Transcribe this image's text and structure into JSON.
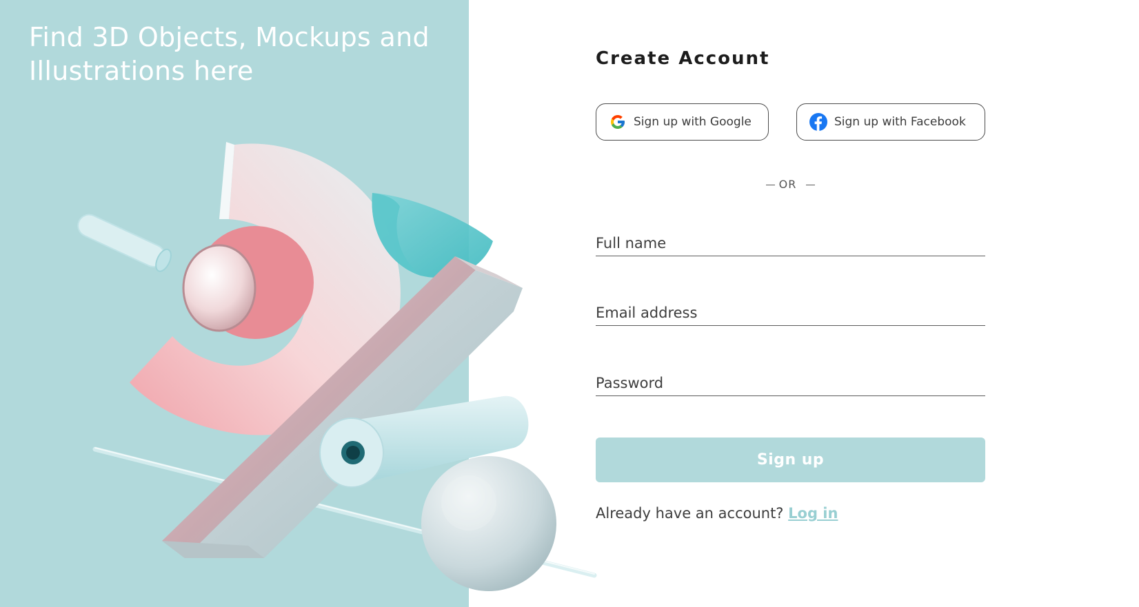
{
  "hero": {
    "title": "Find 3D Objects, Mockups and Illustrations here"
  },
  "form": {
    "title": "Create Account",
    "google_label": "Sign up with Google",
    "facebook_label": "Sign up with Facebook",
    "divider_label": "OR",
    "fields": {
      "full_name": {
        "value": "",
        "placeholder": "Full name"
      },
      "email": {
        "value": "",
        "placeholder": "Email address"
      },
      "password": {
        "value": "",
        "placeholder": "Password"
      }
    },
    "submit_label": "Sign up",
    "login_prompt": "Already have an account?",
    "login_link": "Log in"
  },
  "icons": {
    "google": "google-icon",
    "facebook": "facebook-icon"
  },
  "colors": {
    "panel": "#b1d9db",
    "accent": "#98cfd2",
    "facebook": "#1877f2",
    "text": "#1c1c1c"
  }
}
